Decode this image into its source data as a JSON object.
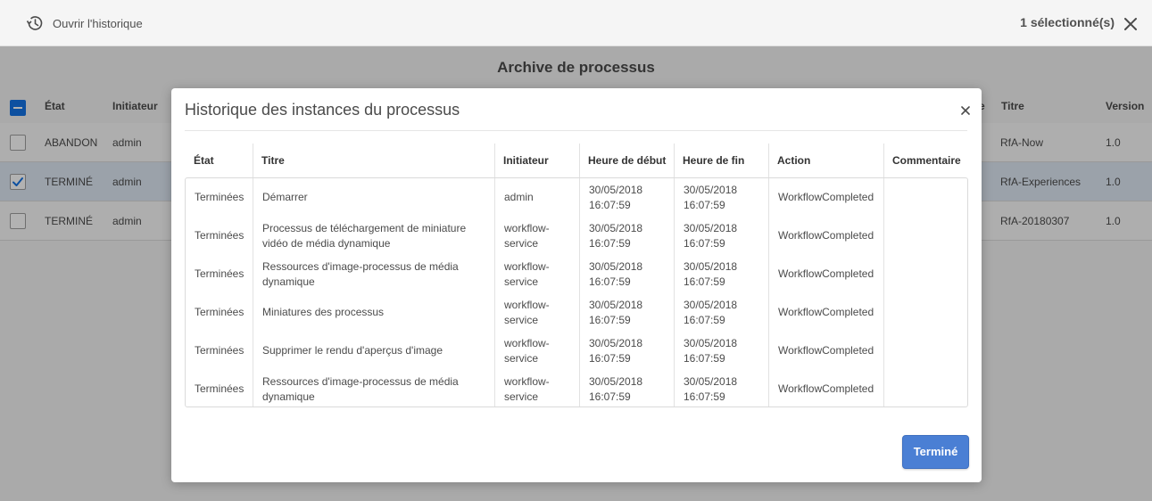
{
  "actionbar": {
    "history_label": "Ouvrir l'historique",
    "selection_count": "1 sélectionné(s)"
  },
  "archive": {
    "title": "Archive de processus",
    "headers": {
      "state": "État",
      "initiator": "Initiateur",
      "title_col_suffix": "e",
      "title": "Titre",
      "version": "Version"
    },
    "rows": [
      {
        "state": "ABANDON",
        "initiator": "admin",
        "title": "RfA-Now",
        "version": "1.0",
        "selected": false
      },
      {
        "state": "TERMINÉ",
        "initiator": "admin",
        "title": "RfA-Experiences",
        "version": "1.0",
        "selected": true
      },
      {
        "state": "TERMINÉ",
        "initiator": "admin",
        "title": "RfA-20180307",
        "version": "1.0",
        "selected": false
      }
    ]
  },
  "dialog": {
    "title": "Historique des instances du processus",
    "headers": {
      "state": "État",
      "title": "Titre",
      "initiator": "Initiateur",
      "start": "Heure de début",
      "end": "Heure de fin",
      "action": "Action",
      "comment": "Commentaire"
    },
    "rows": [
      {
        "state": "Terminées",
        "title": "Démarrer",
        "initiator": "admin",
        "start": "30/05/2018 16:07:59",
        "end": "30/05/2018 16:07:59",
        "action": "WorkflowCompleted",
        "comment": ""
      },
      {
        "state": "Terminées",
        "title": "Processus de téléchargement de miniature vidéo de média dynamique",
        "initiator": "workflow-service",
        "start": "30/05/2018 16:07:59",
        "end": "30/05/2018 16:07:59",
        "action": "WorkflowCompleted",
        "comment": ""
      },
      {
        "state": "Terminées",
        "title": "Ressources d'image-processus de média dynamique",
        "initiator": "workflow-service",
        "start": "30/05/2018 16:07:59",
        "end": "30/05/2018 16:07:59",
        "action": "WorkflowCompleted",
        "comment": ""
      },
      {
        "state": "Terminées",
        "title": "Miniatures des processus",
        "initiator": "workflow-service",
        "start": "30/05/2018 16:07:59",
        "end": "30/05/2018 16:07:59",
        "action": "WorkflowCompleted",
        "comment": ""
      },
      {
        "state": "Terminées",
        "title": "Supprimer le rendu d'aperçus d'image",
        "initiator": "workflow-service",
        "start": "30/05/2018 16:07:59",
        "end": "30/05/2018 16:07:59",
        "action": "WorkflowCompleted",
        "comment": ""
      },
      {
        "state": "Terminées",
        "title": "Ressources d'image-processus de média dynamique",
        "initiator": "workflow-service",
        "start": "30/05/2018 16:07:59",
        "end": "30/05/2018 16:07:59",
        "action": "WorkflowCompleted",
        "comment": ""
      }
    ],
    "done_label": "Terminé"
  },
  "colors": {
    "accent": "#1473e6",
    "done_button": "#4a7fd4",
    "selected_row": "#dfe8f4"
  },
  "icons": {
    "history": "history-icon",
    "close": "close-icon",
    "checkbox_checked": "checkmark-icon"
  }
}
